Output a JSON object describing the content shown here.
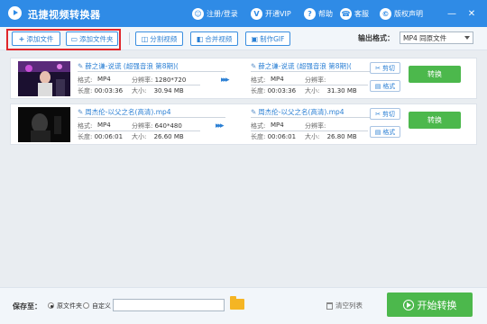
{
  "app": {
    "title": "迅捷视频转换器"
  },
  "top_links": [
    {
      "label": "注册/登录",
      "icon": "user-icon",
      "glyph": "☺"
    },
    {
      "label": "开通VIP",
      "icon": "vip-icon",
      "glyph": "V"
    },
    {
      "label": "帮助",
      "icon": "help-icon",
      "glyph": "?"
    },
    {
      "label": "客服",
      "icon": "headset-icon",
      "glyph": "☎"
    },
    {
      "label": "版权声明",
      "icon": "copyright-icon",
      "glyph": "©"
    }
  ],
  "window_controls": {
    "min": "—",
    "close": "✕"
  },
  "toolbar": {
    "add_file": "添加文件",
    "add_folder": "添加文件夹",
    "split_video": "分割视频",
    "merge_video": "合并视频",
    "make_gif": "制作GIF",
    "format_label": "输出格式：",
    "format_value": "MP4   同原文件"
  },
  "items": [
    {
      "src_name": "薛之谦-说谎 (超强音浪 第8期)(",
      "format_label": "格式:",
      "format": "MP4",
      "res_label": "分辨率:",
      "resolution": "1280*720",
      "dur_label": "长度:",
      "duration": "00:03:36",
      "size_label": "大小:",
      "size": "30.94 MB",
      "dst_name": "薛之谦-说谎 (超强音浪 第8期)(",
      "dst_format": "MP4",
      "dst_resolution": "",
      "dst_duration": "00:03:36",
      "dst_size": "31.30 MB",
      "cut_label": "剪切",
      "fmt_label": "格式",
      "convert_label": "转换"
    },
    {
      "src_name": "周杰伦-以父之名(高清).mp4",
      "format_label": "格式:",
      "format": "MP4",
      "res_label": "分辨率:",
      "resolution": "640*480",
      "dur_label": "长度:",
      "duration": "00:06:01",
      "size_label": "大小:",
      "size": "26.60 MB",
      "dst_name": "周杰伦-以父之名(高清).mp4",
      "dst_format": "MP4",
      "dst_resolution": "",
      "dst_duration": "00:06:01",
      "dst_size": "26.80 MB",
      "cut_label": "剪切",
      "fmt_label": "格式",
      "convert_label": "转换"
    }
  ],
  "footer": {
    "save_to": "保存至：",
    "option_source": "原文件夹",
    "option_custom": "自定义",
    "path_value": "",
    "clear_list": "清空列表",
    "start_convert": "开始转换"
  },
  "colors": {
    "title_bar": "#2f8be6",
    "accent_green": "#4cb84c",
    "highlight_red": "#e0262b"
  }
}
